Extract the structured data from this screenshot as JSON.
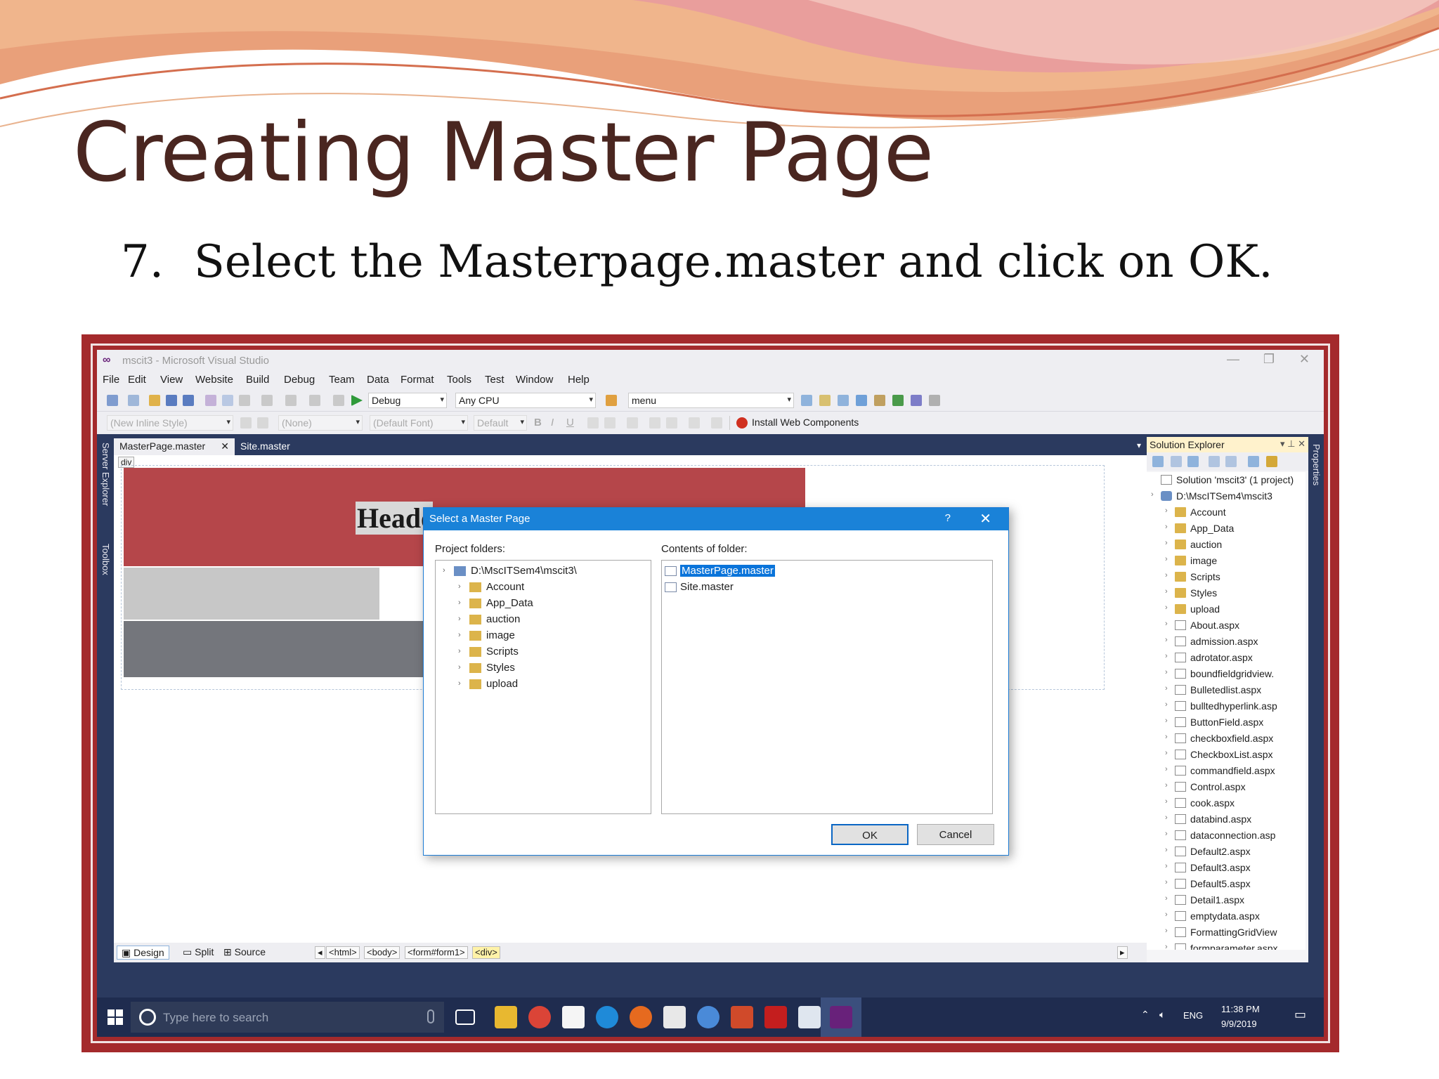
{
  "slide": {
    "title": "Creating Master Page",
    "step_number": "7.",
    "step_text": "Select the Masterpage.master and click on OK."
  },
  "vs": {
    "window_title": "mscit3 - Microsoft Visual Studio",
    "menu": [
      "File",
      "Edit",
      "View",
      "Website",
      "Build",
      "Debug",
      "Team",
      "Data",
      "Format",
      "Tools",
      "Test",
      "Window",
      "Help"
    ],
    "toolbar": {
      "config": "Debug",
      "platform": "Any CPU",
      "find": "menu",
      "style": "(New Inline Style)",
      "block": "(None)",
      "font": "(Default Font)",
      "size": "Default",
      "bold": "B",
      "italic": "I",
      "underline": "U",
      "install_web_components": "Install Web Components"
    },
    "left_strip": {
      "server_explorer": "Server Explorer",
      "toolbox": "Toolbox"
    },
    "right_strip": {
      "properties": "Properties"
    },
    "doc_tabs": [
      "MasterPage.master",
      "Site.master"
    ],
    "design": {
      "div_tag": "div",
      "header_text": "Header"
    },
    "view_bar": {
      "design": "Design",
      "split": "Split",
      "source": "Source",
      "tags": [
        "<html>",
        "<body>",
        "<form#form1>",
        "<div>"
      ]
    },
    "solution_explorer": {
      "title": "Solution Explorer",
      "solution": "Solution 'mscit3' (1 project)",
      "project": "D:\\MscITSem4\\mscit3",
      "folders": [
        "Account",
        "App_Data",
        "auction",
        "image",
        "Scripts",
        "Styles",
        "upload"
      ],
      "files": [
        "About.aspx",
        "admission.aspx",
        "adrotator.aspx",
        "boundfieldgridview.",
        "Bulletedlist.aspx",
        "bulltedhyperlink.asp",
        "ButtonField.aspx",
        "checkboxfield.aspx",
        "CheckboxList.aspx",
        "commandfield.aspx",
        "Control.aspx",
        "cook.aspx",
        "databind.aspx",
        "dataconnection.asp",
        "Default2.aspx",
        "Default3.aspx",
        "Default5.aspx",
        "Detail1.aspx",
        "emptydata.aspx",
        "FormattingGridView",
        "formparameter.aspx"
      ]
    }
  },
  "dialog": {
    "title": "Select a Master Page",
    "help": "?",
    "project_folders_label": "Project folders:",
    "contents_label": "Contents of folder:",
    "root": "D:\\MscITSem4\\mscit3\\",
    "folders": [
      "Account",
      "App_Data",
      "auction",
      "image",
      "Scripts",
      "Styles",
      "upload"
    ],
    "contents": [
      "MasterPage.master",
      "Site.master"
    ],
    "selected": "MasterPage.master",
    "ok": "OK",
    "cancel": "Cancel"
  },
  "taskbar": {
    "search_placeholder": "Type here to search",
    "language": "ENG",
    "time": "11:38 PM",
    "date": "9/9/2019"
  }
}
